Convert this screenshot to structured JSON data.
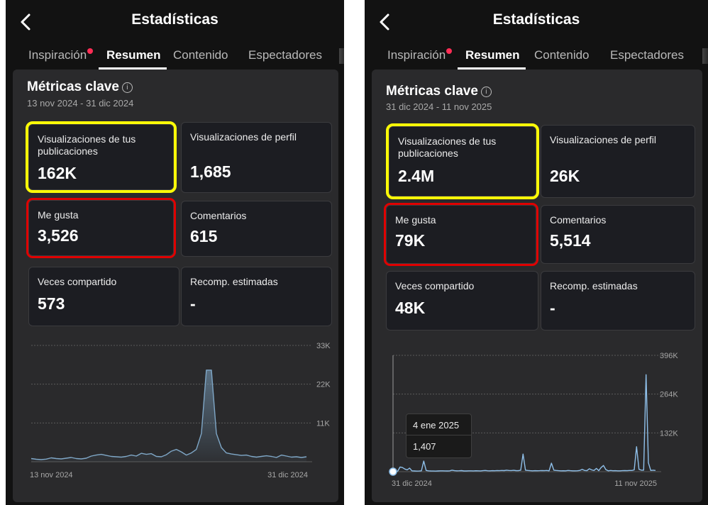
{
  "panels": [
    {
      "title": "Estadísticas",
      "tabs": [
        "Inspiración",
        "Resumen",
        "Contenido",
        "Espectadores"
      ],
      "active_tab": "Resumen",
      "section_title": "Métricas clave",
      "date_range": "13 nov 2024 - 31 dic 2024",
      "metrics": [
        {
          "label": "Visualizaciones de tus publicaciones",
          "value": "162K",
          "highlight": "yellow"
        },
        {
          "label": "Visualizaciones de perfil",
          "value": "1,685",
          "highlight": ""
        },
        {
          "label": "Me gusta",
          "value": "3,526",
          "highlight": "red"
        },
        {
          "label": "Comentarios",
          "value": "615",
          "highlight": ""
        },
        {
          "label": "Veces compartido",
          "value": "573",
          "highlight": ""
        },
        {
          "label": "Recomp. estimadas",
          "value": "-",
          "highlight": ""
        }
      ],
      "chart_data": {
        "type": "area",
        "x_start_label": "13 nov 2024",
        "x_end_label": "31 dic 2024",
        "y_ticks": [
          "33K",
          "22K",
          "11K"
        ],
        "y_tick_values": [
          33000,
          22000,
          11000
        ],
        "ylim": [
          0,
          33000
        ],
        "grid": true,
        "values": [
          900,
          700,
          600,
          750,
          1100,
          900,
          800,
          1000,
          1200,
          900,
          800,
          1000,
          1600,
          1900,
          2100,
          1800,
          1500,
          1400,
          1300,
          1500,
          1900,
          1600,
          2400,
          2100,
          2300,
          1500,
          1400,
          2000,
          3000,
          3500,
          2800,
          1900,
          2500,
          3500,
          8000,
          26000,
          26000,
          8000,
          4000,
          2500,
          2200,
          2000,
          1800,
          1900,
          1500,
          1300,
          1500,
          1700,
          1500,
          1200,
          1900,
          1600,
          1300,
          1400,
          1200,
          1400
        ],
        "color": "#7fa7c7"
      }
    },
    {
      "title": "Estadísticas",
      "tabs": [
        "Inspiración",
        "Resumen",
        "Contenido",
        "Espectadores"
      ],
      "active_tab": "Resumen",
      "section_title": "Métricas clave",
      "date_range": "31 dic 2024 - 11 nov 2025",
      "metrics": [
        {
          "label": "Visualizaciones de tus publicaciones",
          "value": "2.4M",
          "highlight": "yellow"
        },
        {
          "label": "Visualizaciones de perfil",
          "value": "26K",
          "highlight": ""
        },
        {
          "label": "Me gusta",
          "value": "79K",
          "highlight": "red"
        },
        {
          "label": "Comentarios",
          "value": "5,514",
          "highlight": ""
        },
        {
          "label": "Veces compartido",
          "value": "48K",
          "highlight": ""
        },
        {
          "label": "Recomp. estimadas",
          "value": "-",
          "highlight": ""
        }
      ],
      "tooltip": {
        "date": "4 ene 2025",
        "value": "1,407"
      },
      "chart_data": {
        "type": "line",
        "x_start_label": "31 dic 2024",
        "x_end_label": "11 nov 2025",
        "y_ticks": [
          "396K",
          "264K",
          "132K"
        ],
        "y_tick_values": [
          396000,
          264000,
          132000
        ],
        "ylim": [
          0,
          396000
        ],
        "grid": true,
        "values": [
          1000,
          1407,
          2000,
          16000,
          14000,
          9000,
          6000,
          12000,
          3000,
          2500,
          2000,
          2200,
          3000,
          36000,
          4000,
          3000,
          2500,
          2200,
          2000,
          2300,
          2800,
          3000,
          2600,
          2400,
          3000,
          5000,
          3500,
          2800,
          3200,
          3600,
          2500,
          2400,
          3000,
          2800,
          2600,
          3200,
          2900,
          2700,
          3500,
          4000,
          3200,
          3000,
          3300,
          3100,
          3800,
          3500,
          4200,
          3600,
          5000,
          4000,
          3800,
          4500,
          3700,
          3500,
          5000,
          60000,
          5000,
          4000,
          3500,
          3000,
          3300,
          3100,
          3500,
          3800,
          3400,
          4000,
          3000,
          29000,
          5000,
          4200,
          3500,
          3000,
          3200,
          3000,
          4000,
          3500,
          2800,
          3000,
          3200,
          4000,
          8000,
          4000,
          3500,
          10000,
          6000,
          4000,
          11000,
          3500,
          14000,
          21000,
          7000,
          3000,
          4000,
          3200,
          3500,
          3000,
          3000,
          3500,
          3800,
          3500,
          4200,
          4000,
          6000,
          85000,
          8000,
          5000,
          5000,
          330000,
          30000,
          4000,
          5000,
          4000
        ],
        "color": "#8fc0ea"
      }
    }
  ]
}
